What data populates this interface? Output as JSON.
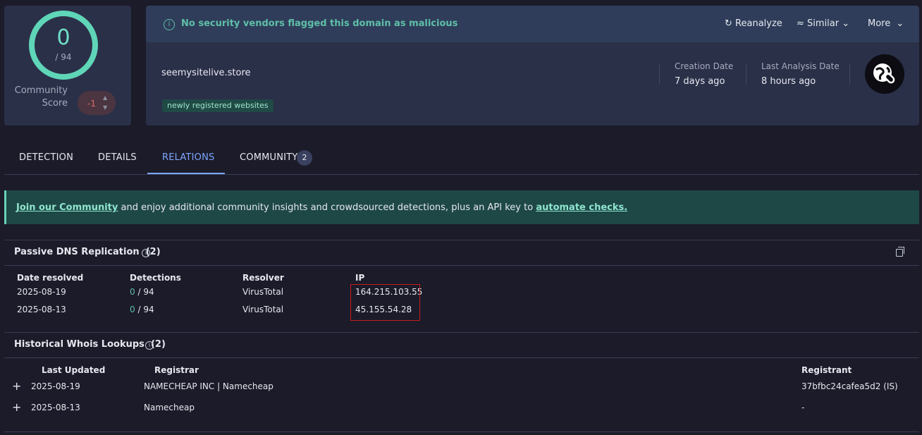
{
  "score": {
    "detections": "0",
    "total": "/ 94",
    "community_label_1": "Community",
    "community_label_2": "Score",
    "community_value": "-1"
  },
  "banner": {
    "text": "No security vendors flagged this domain as malicious",
    "reanalyze": "Reanalyze",
    "similar": "Similar",
    "more": "More"
  },
  "domain": {
    "name": "seemysitelive.store",
    "tag": "newly registered websites",
    "creation_label": "Creation Date",
    "creation_value": "7 days ago",
    "analysis_label": "Last Analysis Date",
    "analysis_value": "8 hours ago"
  },
  "tabs": [
    {
      "label": "DETECTION"
    },
    {
      "label": "DETAILS"
    },
    {
      "label": "RELATIONS"
    },
    {
      "label": "COMMUNITY"
    }
  ],
  "community_badge": "2",
  "community_banner": {
    "link1": "Join our Community",
    "middle": " and enjoy additional community insights and crowdsourced detections, plus an API key to ",
    "link2": "automate checks."
  },
  "dns": {
    "title": "Passive DNS Replication",
    "count": "(2)",
    "headers": [
      "Date resolved",
      "Detections",
      "Resolver",
      "IP"
    ],
    "rows": [
      {
        "date": "2025-08-19",
        "det": "0",
        "total": "/ 94",
        "resolver": "VirusTotal",
        "ip": "164.215.103.55"
      },
      {
        "date": "2025-08-13",
        "det": "0",
        "total": "/ 94",
        "resolver": "VirusTotal",
        "ip": "45.155.54.28"
      }
    ]
  },
  "whois": {
    "title": "Historical Whois Lookups",
    "count": "(2)",
    "headers": [
      "Last Updated",
      "Registrar",
      "Registrant"
    ],
    "rows": [
      {
        "date": "2025-08-19",
        "registrar": "NAMECHEAP INC | Namecheap",
        "registrant": "37bfbc24cafea5d2 (IS)"
      },
      {
        "date": "2025-08-13",
        "registrar": "Namecheap",
        "registrant": "-"
      }
    ]
  }
}
